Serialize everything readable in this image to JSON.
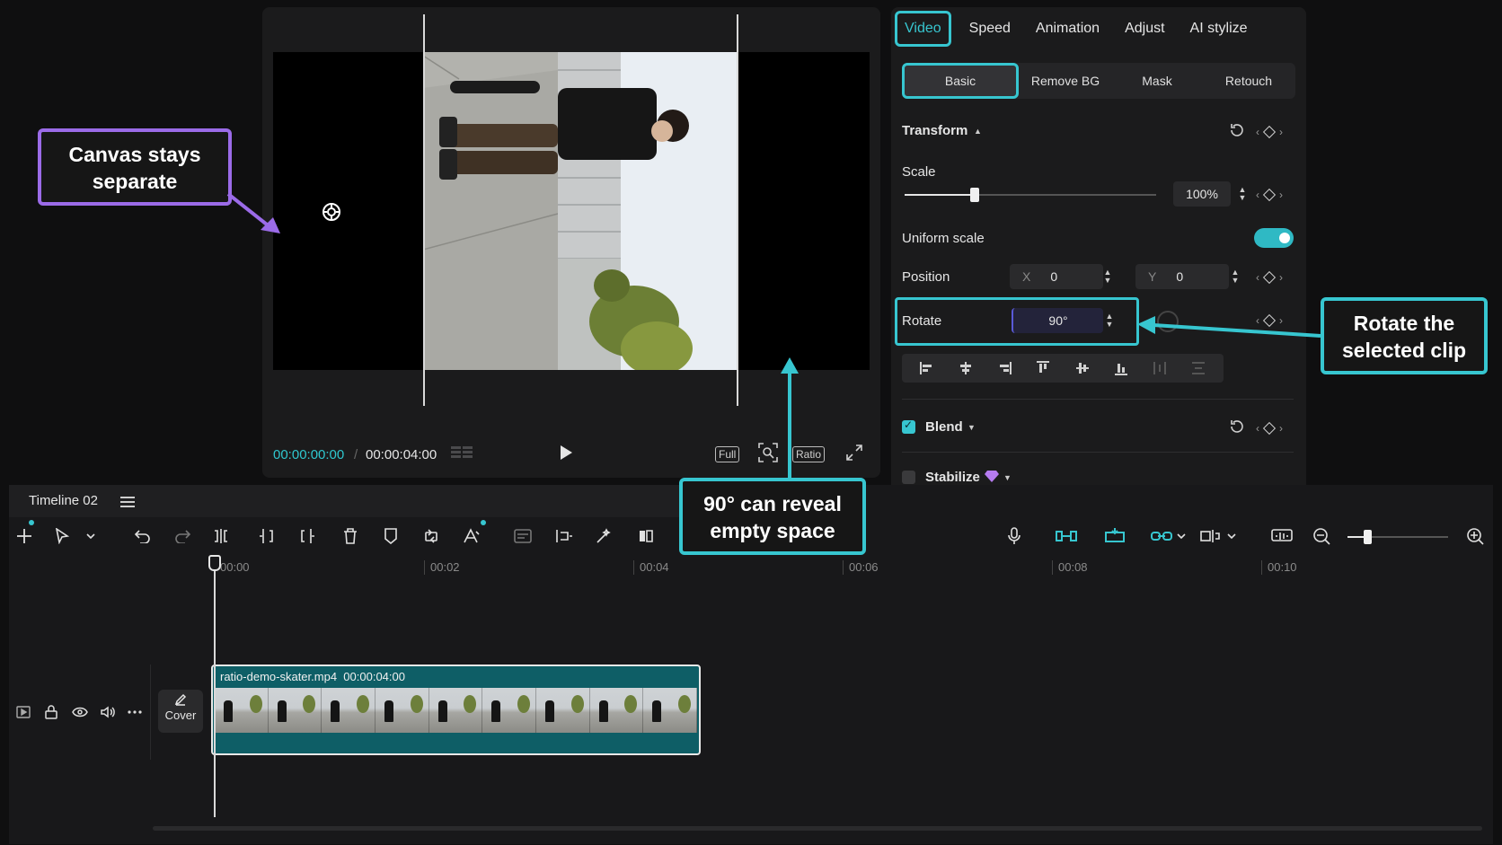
{
  "player": {
    "current_time": "00:00:00:00",
    "separator": "/",
    "total_time": "00:00:04:00",
    "full_label": "Full",
    "ratio_label": "Ratio"
  },
  "inspector": {
    "tabs": [
      "Video",
      "Speed",
      "Animation",
      "Adjust",
      "AI stylize"
    ],
    "active_tab": "Video",
    "subtabs": [
      "Basic",
      "Remove BG",
      "Mask",
      "Retouch"
    ],
    "active_subtab": "Basic",
    "transform_label": "Transform",
    "scale_label": "Scale",
    "scale_value": "100%",
    "scale_level": 0.28,
    "uniform_scale_label": "Uniform scale",
    "uniform_scale_on": true,
    "position_label": "Position",
    "x_label": "X",
    "x_value": "0",
    "y_label": "Y",
    "y_value": "0",
    "rotate_label": "Rotate",
    "rotate_value": "90°",
    "blend_label": "Blend",
    "blend_checked": true,
    "stabilize_label": "Stabilize",
    "stabilize_checked": false,
    "accent_color": "#37c6d0"
  },
  "timeline": {
    "title": "Timeline 02",
    "ruler": [
      "00:00",
      "00:02",
      "00:04",
      "00:06",
      "00:08",
      "00:10"
    ],
    "clip_name": "ratio-demo-skater.mp4",
    "clip_duration": "00:00:04:00",
    "cover_label": "Cover"
  },
  "callouts": {
    "canvas": "Canvas stays separate",
    "reveal": "90° can reveal empty space",
    "rotate": "Rotate the selected clip",
    "purple": "#9b6be8",
    "teal": "#37c6d0"
  }
}
